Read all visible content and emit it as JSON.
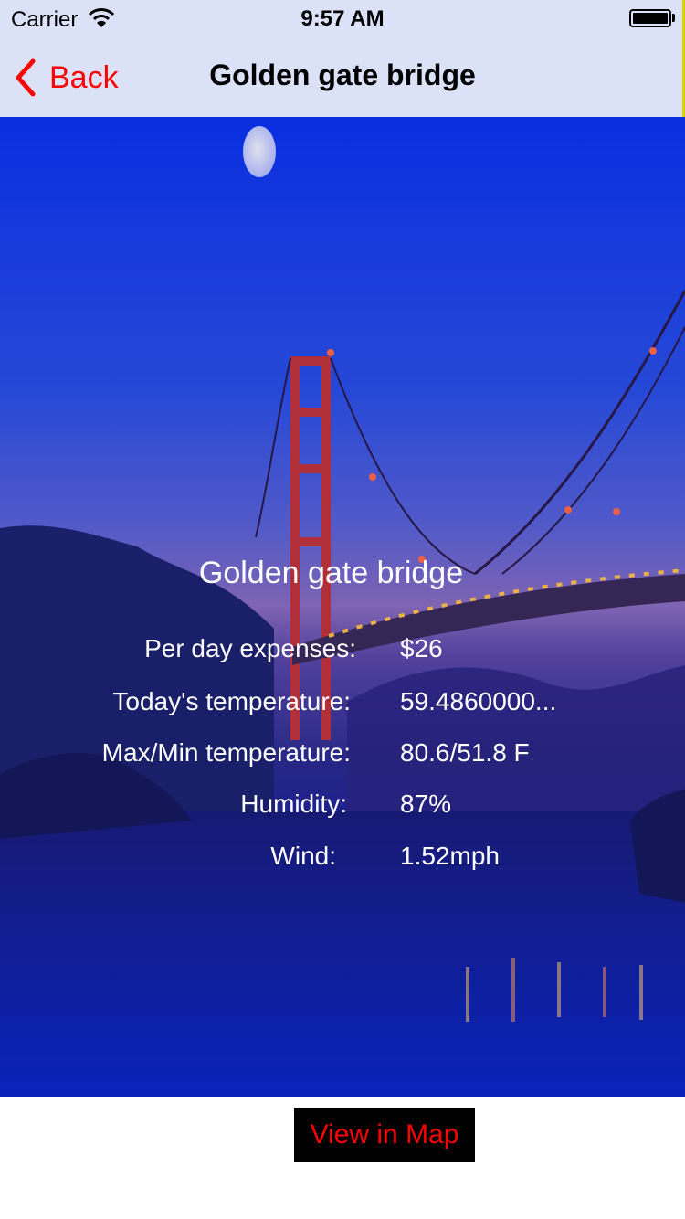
{
  "status_bar": {
    "carrier": "Carrier",
    "time": "9:57 AM"
  },
  "nav": {
    "back_label": "Back",
    "title": "Golden gate bridge"
  },
  "place": {
    "name": "Golden gate bridge",
    "details": [
      {
        "label": "Per day expenses:",
        "value": "$26"
      },
      {
        "label": "Today's temperature:",
        "value": "59.4860000..."
      },
      {
        "label": "Max/Min temperature:",
        "value": "80.6/51.8 F"
      },
      {
        "label": "Humidity:",
        "value": "87%"
      },
      {
        "label": "Wind:",
        "value": "1.52mph"
      }
    ]
  },
  "actions": {
    "map_button": "View in Map"
  },
  "colors": {
    "accent": "#ff0000",
    "nav_background": "#dbe2f8",
    "button_background": "#000000"
  }
}
